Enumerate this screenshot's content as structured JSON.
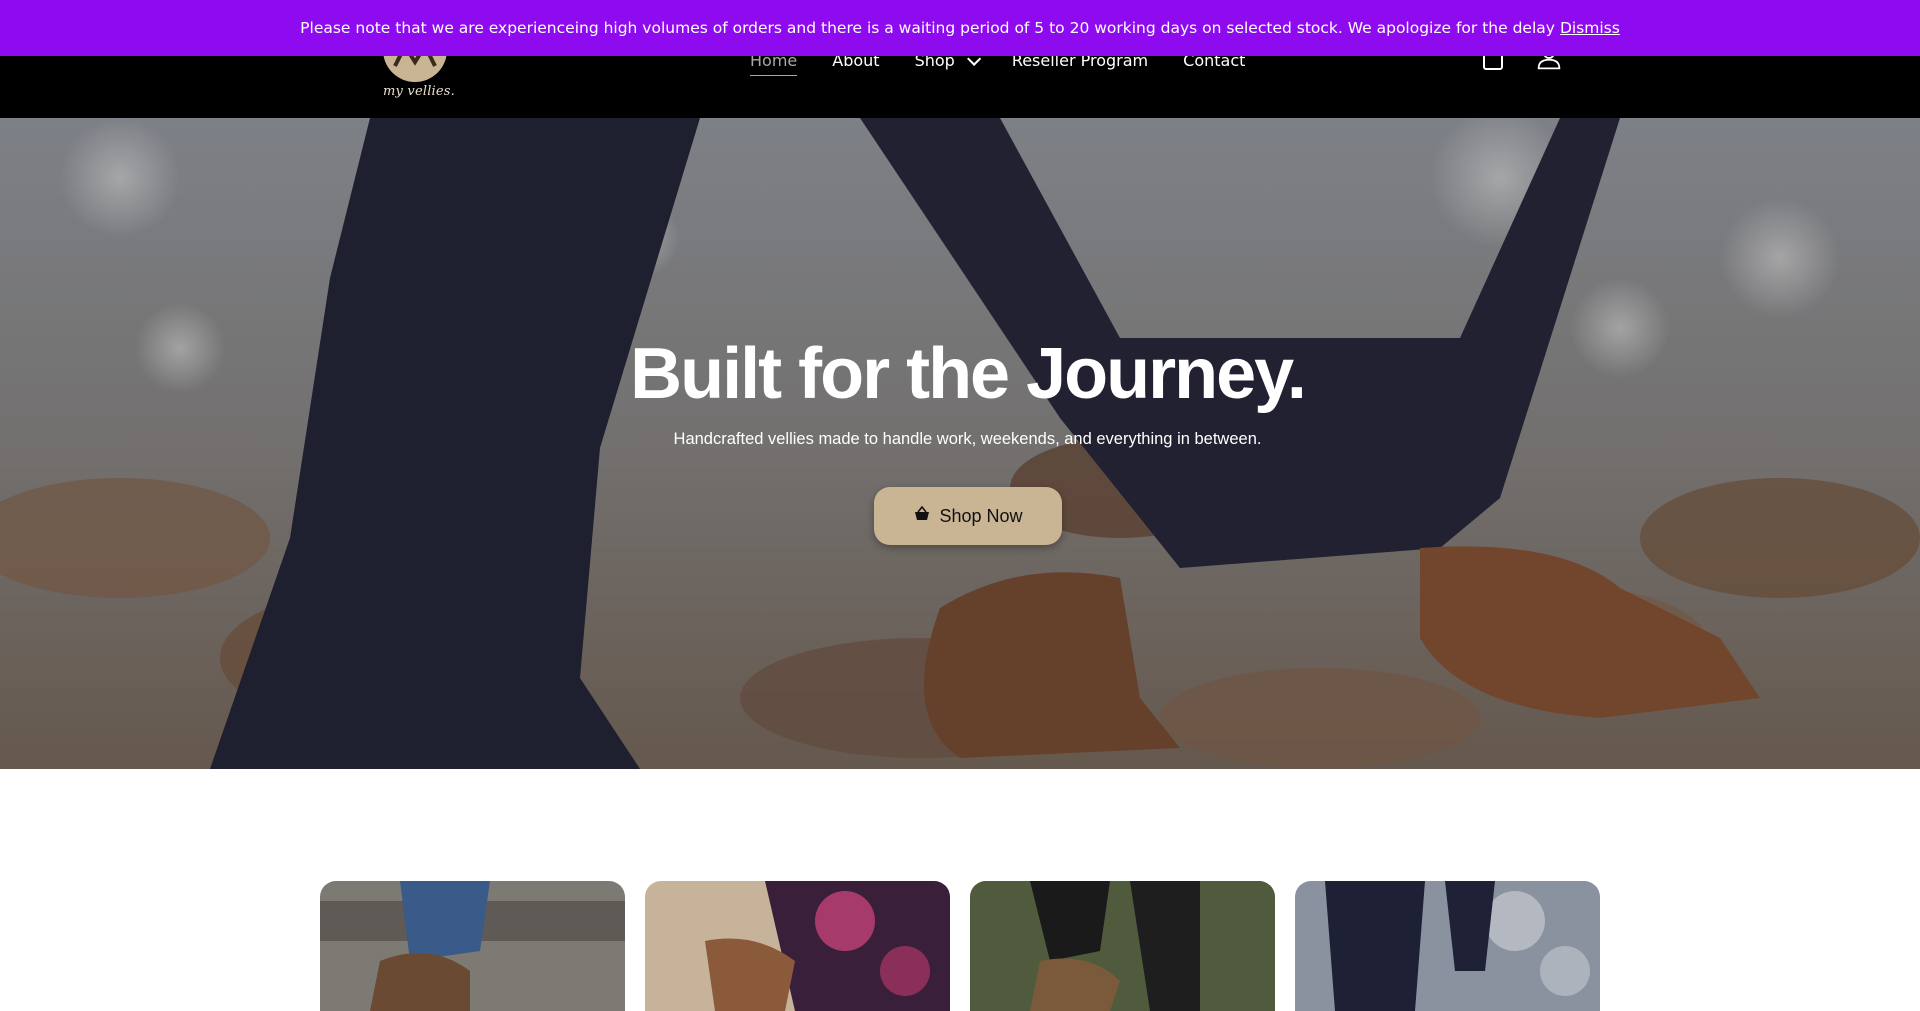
{
  "announcement": {
    "text": "Please note that we are experienceing high volumes of orders and there is a waiting period of 5 to 20 working days on selected stock. We apologize for the delay",
    "dismiss_label": "Dismiss",
    "background": "#8f0bef"
  },
  "header": {
    "logo_text": "my vellies.",
    "nav": [
      {
        "label": "Home",
        "active": true
      },
      {
        "label": "About"
      },
      {
        "label": "Shop",
        "has_dropdown": true
      },
      {
        "label": "Reseller Program"
      },
      {
        "label": "Contact"
      }
    ],
    "icons": [
      "cart-icon",
      "account-icon"
    ]
  },
  "hero": {
    "title": "Built for the Journey.",
    "subtitle": "Handcrafted vellies made to handle work, weekends, and everything in between.",
    "cta_label": "Shop Now",
    "cta_icon": "basket-icon",
    "accent": "#c9b594"
  },
  "cards": [
    {
      "name": "product-card-1"
    },
    {
      "name": "product-card-2"
    },
    {
      "name": "product-card-3"
    },
    {
      "name": "product-card-4"
    }
  ]
}
